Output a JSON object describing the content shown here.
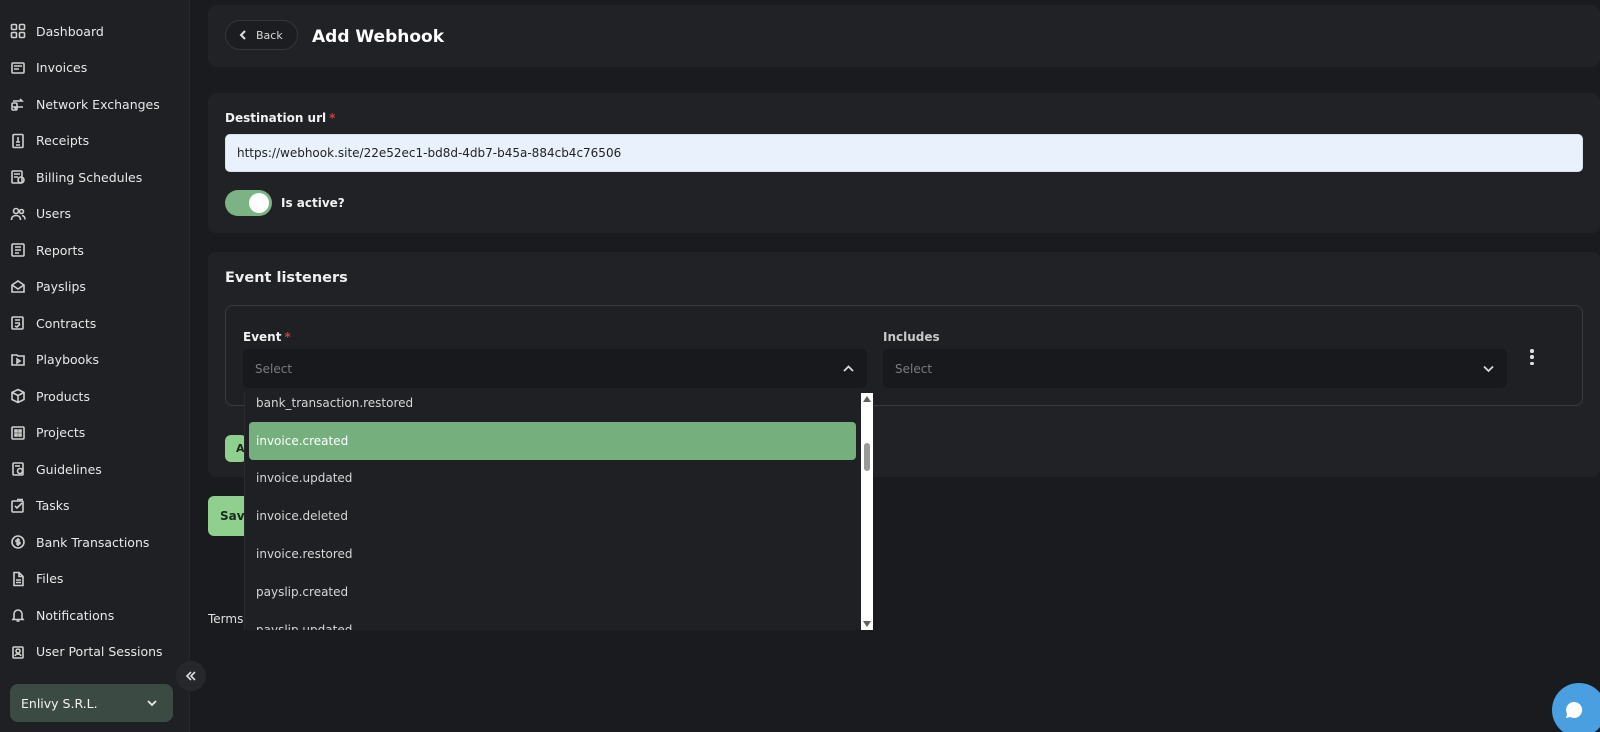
{
  "sidebar": {
    "items": [
      {
        "label": "Dashboard",
        "icon": "dashboard-icon"
      },
      {
        "label": "Invoices",
        "icon": "invoice-icon"
      },
      {
        "label": "Network Exchanges",
        "icon": "exchange-icon"
      },
      {
        "label": "Receipts",
        "icon": "receipt-icon"
      },
      {
        "label": "Billing Schedules",
        "icon": "billing-schedule-icon"
      },
      {
        "label": "Users",
        "icon": "users-icon"
      },
      {
        "label": "Reports",
        "icon": "reports-icon"
      },
      {
        "label": "Payslips",
        "icon": "payslip-icon"
      },
      {
        "label": "Contracts",
        "icon": "contract-icon"
      },
      {
        "label": "Playbooks",
        "icon": "playbook-icon"
      },
      {
        "label": "Products",
        "icon": "product-box-icon"
      },
      {
        "label": "Projects",
        "icon": "project-icon"
      },
      {
        "label": "Guidelines",
        "icon": "guidelines-icon"
      },
      {
        "label": "Tasks",
        "icon": "tasks-icon"
      },
      {
        "label": "Bank Transactions",
        "icon": "bank-icon"
      },
      {
        "label": "Files",
        "icon": "file-icon"
      },
      {
        "label": "Notifications",
        "icon": "bell-icon"
      },
      {
        "label": "User Portal Sessions",
        "icon": "portal-session-icon"
      }
    ],
    "org_name": "Enlivy S.R.L."
  },
  "header": {
    "back_label": "Back",
    "title": "Add Webhook"
  },
  "destination": {
    "label": "Destination url",
    "required_mark": "*",
    "value": "https://webhook.site/22e52ec1-bd8d-4db7-b45a-884cb4c76506",
    "is_active": true,
    "active_label": "Is active?"
  },
  "events": {
    "section_title": "Event listeners",
    "event_label": "Event",
    "required_mark": "*",
    "event_placeholder": "Select",
    "includes_label": "Includes",
    "includes_placeholder": "Select",
    "add_label": "Add",
    "dropdown_options": [
      {
        "label": "bank_transaction.restored",
        "selected": false
      },
      {
        "label": "invoice.created",
        "selected": true
      },
      {
        "label": "invoice.updated",
        "selected": false
      },
      {
        "label": "invoice.deleted",
        "selected": false
      },
      {
        "label": "invoice.restored",
        "selected": false
      },
      {
        "label": "payslip.created",
        "selected": false
      },
      {
        "label": "payslip.updated",
        "selected": false
      }
    ]
  },
  "footer": {
    "save_label": "Save",
    "terms_label": "Terms"
  },
  "colors": {
    "accent_green": "#8fd08e",
    "selected_option": "#75af7d",
    "toggle_on": "#7bb384",
    "chat_blue": "#4a9fe0",
    "required_red": "#c2433d"
  }
}
